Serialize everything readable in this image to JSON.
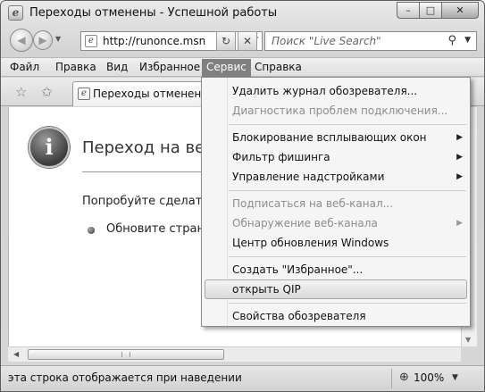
{
  "window": {
    "title": "Переходы отменены - Успешной работы",
    "controls": [
      "minimize",
      "maximize",
      "close"
    ]
  },
  "navigation": {
    "address": "http://runonce.msn",
    "search_placeholder": "Поиск \"Live Search\""
  },
  "menubar": {
    "items": [
      "Файл",
      "Правка",
      "Вид",
      "Избранное",
      "Сервис",
      "Справка"
    ],
    "active": "Сервис"
  },
  "tab": {
    "label": "Переходы отменены"
  },
  "content": {
    "heading": "Переход на веб-",
    "try_text": "Попробуйте сделать",
    "bullet_text": "Обновите страни"
  },
  "service_menu": {
    "items": [
      {
        "label": "Удалить журнал обозревателя...",
        "enabled": true,
        "submenu": false
      },
      {
        "label": "Диагностика проблем подключения...",
        "enabled": false,
        "submenu": false
      },
      {
        "label": "Блокирование всплывающих окон",
        "enabled": true,
        "submenu": true
      },
      {
        "label": "Фильтр фишинга",
        "enabled": true,
        "submenu": true
      },
      {
        "label": "Управление надстройками",
        "enabled": true,
        "submenu": true
      },
      {
        "label": "Подписаться на веб-канал...",
        "enabled": false,
        "submenu": false
      },
      {
        "label": "Обнаружение веб-канала",
        "enabled": false,
        "submenu": true
      },
      {
        "label": "Центр обновления Windows",
        "enabled": true,
        "submenu": false
      },
      {
        "label": "Создать \"Избранное\"...",
        "enabled": true,
        "submenu": false
      },
      {
        "label": "открыть QIP",
        "enabled": true,
        "submenu": false,
        "highlighted": true
      },
      {
        "label": "Свойства обозревателя",
        "enabled": true,
        "submenu": false
      }
    ]
  },
  "statusbar": {
    "text": "эта строка отображается при наведении",
    "zoom": "100%"
  },
  "colors": {
    "menu_active_bg": "#808080",
    "disabled_text": "#8d8d8d"
  }
}
